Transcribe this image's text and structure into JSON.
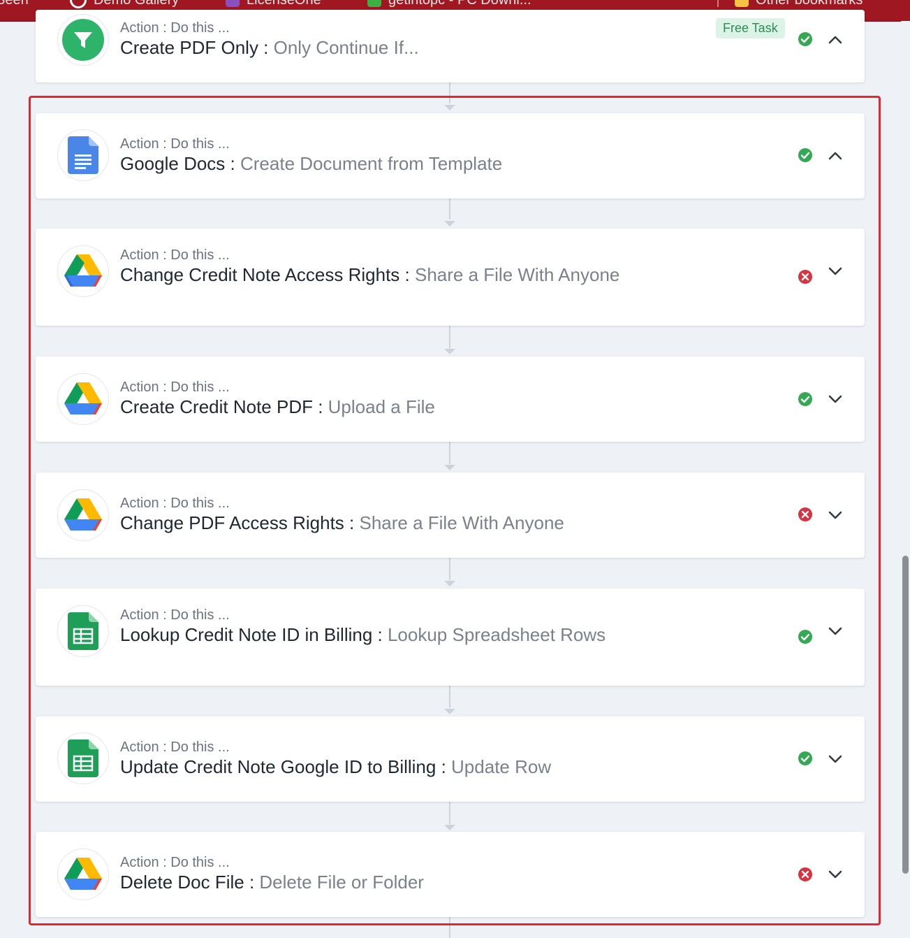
{
  "bookmarks": [
    {
      "label": "Seeh",
      "icon": "bookmark-icon",
      "color": "#9f1720"
    },
    {
      "label": "Demo Gallery",
      "icon": "gallery-icon",
      "color": "#ffffff"
    },
    {
      "label": "LicenseOne",
      "icon": "license-icon",
      "color": "#8b4fbf"
    },
    {
      "label": "getintopc - PC Downl...",
      "icon": "download-icon",
      "color": "#3cb043"
    },
    {
      "label": "Other bookmarks",
      "icon": "folder-icon",
      "color": "#f6c343"
    }
  ],
  "steps": [
    {
      "subtitle": "Action : Do this ...",
      "name": "Create PDF Only",
      "separator": " : ",
      "action": "Only Continue If...",
      "app_icon": "filter-icon",
      "status": "success",
      "expanded": true,
      "badge": "Free Task"
    },
    {
      "subtitle": "Action : Do this ...",
      "name": "Google Docs",
      "separator": " : ",
      "action": "Create Document from Template",
      "app_icon": "google-docs-icon",
      "status": "success",
      "expanded": true
    },
    {
      "subtitle": "Action : Do this ...",
      "name": "Change Credit Note Access Rights",
      "separator": " : ",
      "action": "Share a File With Anyone",
      "app_icon": "google-drive-icon",
      "status": "error",
      "expanded": false
    },
    {
      "subtitle": "Action : Do this ...",
      "name": "Create Credit Note PDF",
      "separator": " : ",
      "action": "Upload a File",
      "app_icon": "google-drive-icon",
      "status": "success",
      "expanded": false
    },
    {
      "subtitle": "Action : Do this ...",
      "name": "Change PDF Access Rights",
      "separator": " : ",
      "action": "Share a File With Anyone",
      "app_icon": "google-drive-icon",
      "status": "error",
      "expanded": false
    },
    {
      "subtitle": "Action : Do this ...",
      "name": "Lookup Credit Note ID in Billing",
      "separator": " : ",
      "action": "Lookup Spreadsheet Rows",
      "app_icon": "google-sheets-icon",
      "status": "success",
      "expanded": false
    },
    {
      "subtitle": "Action : Do this ...",
      "name": "Update Credit Note Google ID to Billing",
      "separator": " : ",
      "action": "Update Row",
      "app_icon": "google-sheets-icon",
      "status": "success",
      "expanded": false
    },
    {
      "subtitle": "Action : Do this ...",
      "name": "Delete Doc File",
      "separator": " : ",
      "action": "Delete File or Folder",
      "app_icon": "google-drive-icon",
      "status": "error",
      "expanded": false
    }
  ],
  "colors": {
    "success": "#34a853",
    "error": "#d93240",
    "highlight": "#e6262e",
    "bookmark_bar": "#9f1720"
  }
}
